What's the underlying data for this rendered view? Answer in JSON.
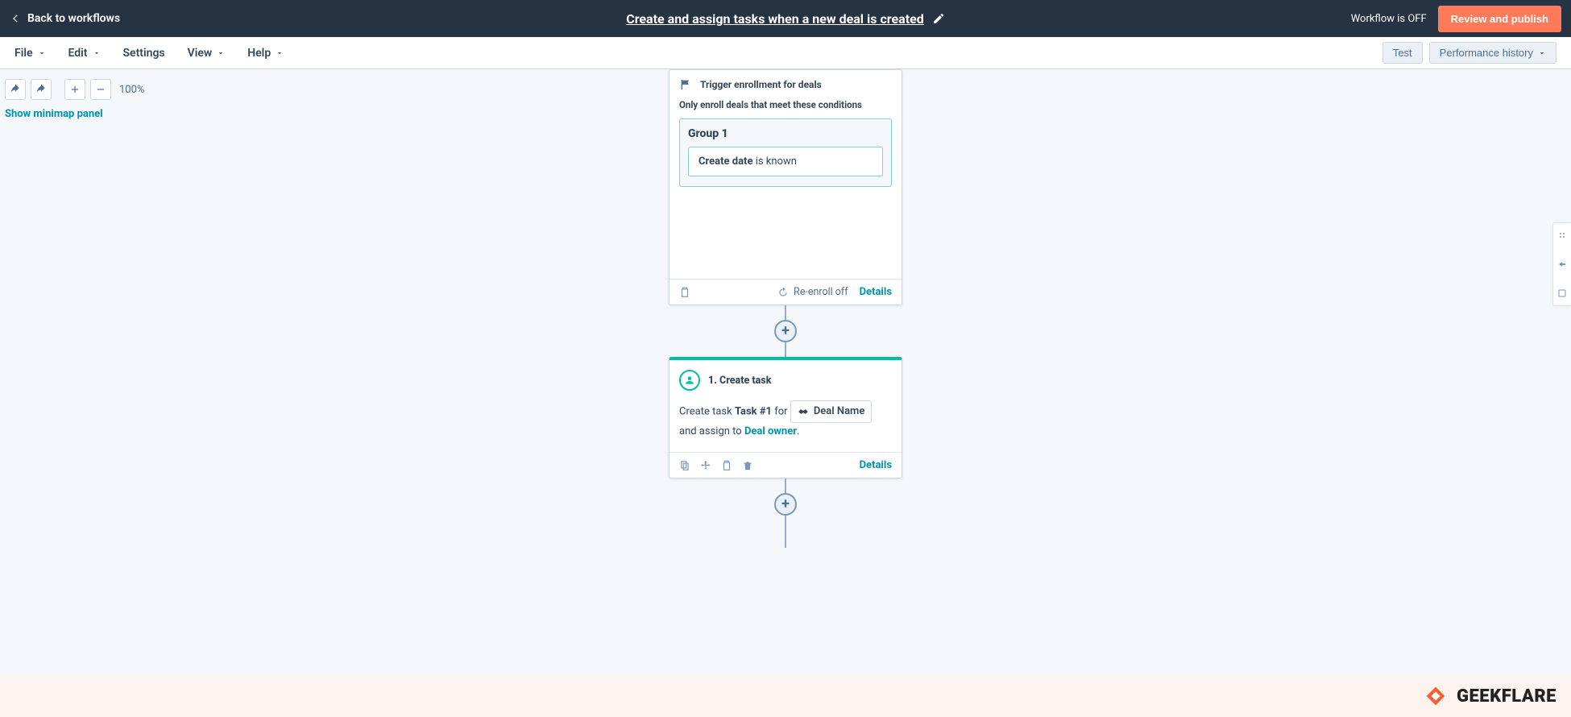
{
  "header": {
    "back_label": "Back to workflows",
    "title": "Create and assign tasks when a new deal is created",
    "status": "Workflow is OFF",
    "publish_label": "Review and publish"
  },
  "menu": {
    "file": "File",
    "edit": "Edit",
    "settings": "Settings",
    "view": "View",
    "help": "Help",
    "test": "Test",
    "perf_history": "Performance history"
  },
  "toolbar": {
    "zoom_label": "100%",
    "minimap_link": "Show minimap panel"
  },
  "trigger": {
    "head": "Trigger enrollment for deals",
    "subtitle": "Only enroll deals that meet these conditions",
    "group_title": "Group 1",
    "cond_prop": "Create date",
    "cond_op": " is known",
    "reenroll": "Re-enroll off",
    "details": "Details"
  },
  "action": {
    "title": "1. Create task",
    "body_prefix": "Create task ",
    "task_name": "Task #1",
    "body_for": " for ",
    "token_label": "Deal Name",
    "body_assign_prefix": "and assign to ",
    "assignee": "Deal owner",
    "details": "Details"
  },
  "watermark": {
    "text": "GEEKFLARE"
  }
}
